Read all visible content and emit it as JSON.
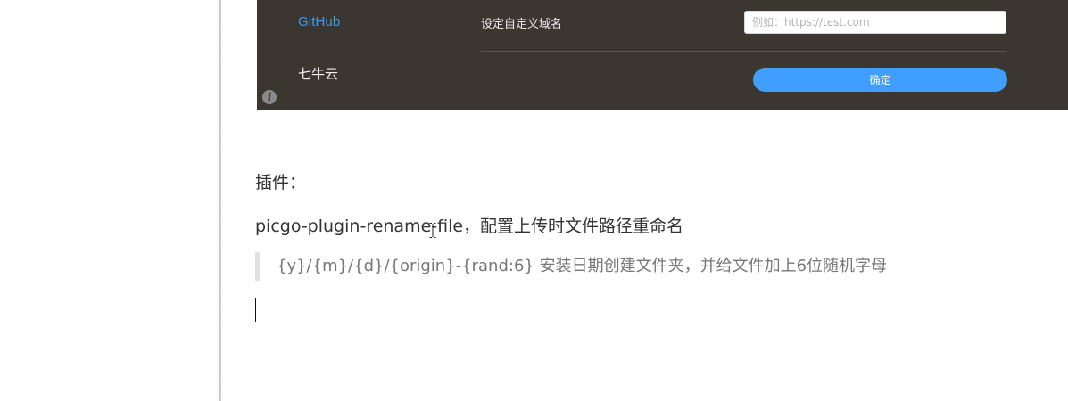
{
  "embedded_screenshot": {
    "nav_items": [
      {
        "label": "GitHub"
      },
      {
        "label": "七牛云"
      }
    ],
    "field_label": "设定自定义域名",
    "domain_input": {
      "value": "",
      "placeholder": "例如：https://test.com"
    },
    "confirm_label": "确定",
    "info_icon_glyph": "i"
  },
  "document": {
    "plugins_heading": "插件：",
    "plugin_line": "picgo-plugin-rename-file，配置上传时文件路径重命名",
    "blockquote": "{y}/{m}/{d}/{origin}-{rand:6}  安装日期创建文件夹，并给文件加上6位随机字母"
  },
  "colors": {
    "screenshot_bg": "#3b3630",
    "link_blue": "#3d9cf0",
    "button_blue": "#409efe",
    "quote_text": "#777777",
    "quote_bar": "#dfe2e5"
  },
  "icons": {
    "info": "info-icon",
    "cursor": "ibeam-cursor-icon"
  }
}
